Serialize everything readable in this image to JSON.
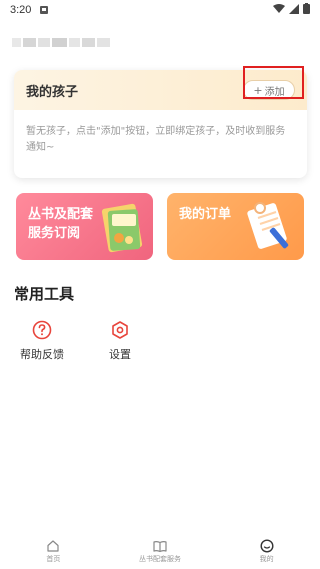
{
  "status_bar": {
    "time": "3:20",
    "icons": [
      "notification-icon",
      "wifi-icon",
      "signal-icon",
      "battery-icon"
    ]
  },
  "user": {
    "name_pixelated": true
  },
  "child_card": {
    "title": "我的孩子",
    "add_label": "添加",
    "empty_text": "暂无孩子，点击\"添加\"按钮，立即绑定孩子，及时收到服务通知~"
  },
  "promos": {
    "books": {
      "line1": "丛书及配套",
      "line2": "服务订阅"
    },
    "orders": {
      "label": "我的订单"
    }
  },
  "tools": {
    "title": "常用工具",
    "items": [
      {
        "label": "帮助反馈",
        "icon": "help-question-icon"
      },
      {
        "label": "设置",
        "icon": "settings-gear-icon"
      }
    ]
  },
  "tabbar": {
    "items": [
      {
        "label": "首页",
        "icon": "home-icon"
      },
      {
        "label": "丛书配套服务",
        "icon": "book-icon"
      },
      {
        "label": "我的",
        "icon": "profile-icon"
      }
    ]
  },
  "colors": {
    "accent_red": "#e8453c",
    "promo_pink": "#f0657e",
    "promo_orange": "#ff9a4a",
    "highlight": "#e02020"
  }
}
